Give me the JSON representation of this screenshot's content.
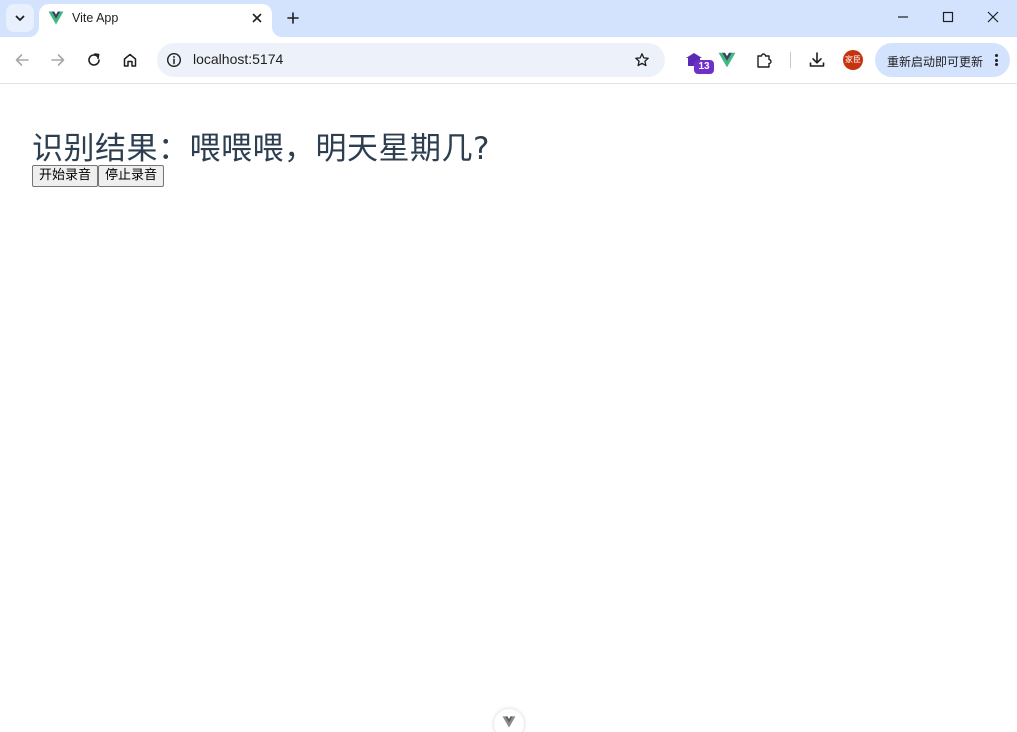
{
  "browser": {
    "tab": {
      "title": "Vite App",
      "favicon": "vue-logo-icon"
    },
    "window_controls": [
      "minimize-icon",
      "maximize-icon",
      "close-icon"
    ],
    "address_bar": {
      "url": "localhost:5174"
    },
    "extensions": {
      "badge_count": "13"
    },
    "profile": {
      "initials": "家臣"
    },
    "update_button": {
      "label": "重新启动即可更新"
    },
    "colors": {
      "tabstrip": "#d3e3fd",
      "omnibox": "#edf2fa",
      "accent_vue_green": "#41b883",
      "accent_vue_dark": "#34495e",
      "extension_badge": "#6f2fc9",
      "profile": "#c5330f"
    }
  },
  "page": {
    "heading": "识别结果：喂喂喂，明天星期几?",
    "buttons": {
      "start": "开始录音",
      "stop": "停止录音"
    },
    "heading_color": "#2c3e50"
  }
}
